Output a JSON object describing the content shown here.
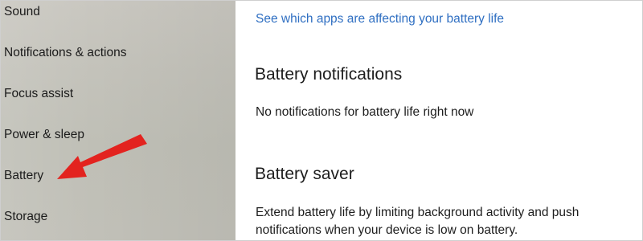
{
  "sidebar": {
    "items": [
      {
        "label": "Sound"
      },
      {
        "label": "Notifications & actions"
      },
      {
        "label": "Focus assist"
      },
      {
        "label": "Power & sleep"
      },
      {
        "label": "Battery"
      },
      {
        "label": "Storage"
      }
    ]
  },
  "main": {
    "link_text": "See which apps are affecting your battery life",
    "notifications_heading": "Battery notifications",
    "notifications_status": "No notifications for battery life right now",
    "saver_heading": "Battery saver",
    "saver_description_line1": "Extend battery life by limiting background activity and push",
    "saver_description_line2": "notifications when your device is low on battery."
  },
  "annotation": {
    "arrow_color": "#e3231f"
  },
  "colors": {
    "link": "#2f6fc2",
    "sidebar_bg": "#c3c2ba",
    "content_bg": "#ffffff"
  }
}
